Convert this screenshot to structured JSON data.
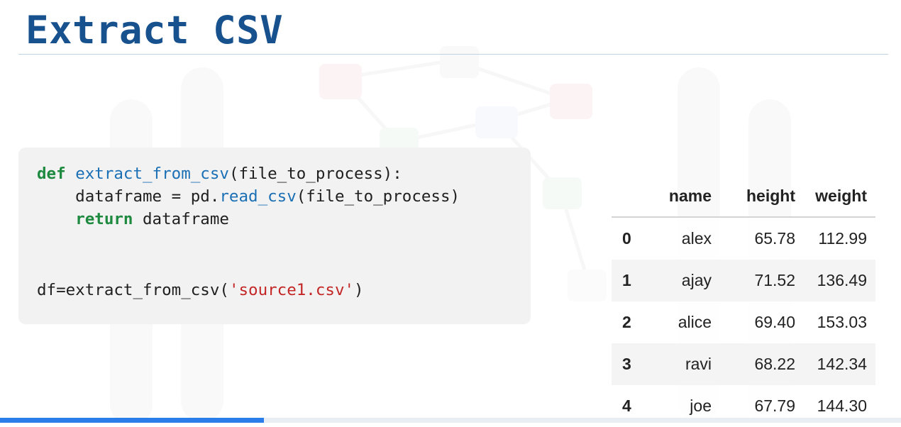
{
  "slide": {
    "title": "Extract CSV"
  },
  "code": {
    "line1": {
      "kw": "def",
      "fn": "extract_from_csv",
      "rest": "(file_to_process):"
    },
    "line2": {
      "pre": "    dataframe = pd.",
      "fn": "read_csv",
      "rest": "(file_to_process)"
    },
    "line3": {
      "indent": "    ",
      "kw": "return",
      "rest": " dataframe"
    },
    "line4": {
      "pre": "df=extract_from_csv(",
      "str": "'source1.csv'",
      "rest": ")"
    }
  },
  "table": {
    "columns": [
      "name",
      "height",
      "weight"
    ],
    "rows": [
      {
        "index": "0",
        "name": "alex",
        "height": "65.78",
        "weight": "112.99"
      },
      {
        "index": "1",
        "name": "ajay",
        "height": "71.52",
        "weight": "136.49"
      },
      {
        "index": "2",
        "name": "alice",
        "height": "69.40",
        "weight": "153.03"
      },
      {
        "index": "3",
        "name": "ravi",
        "height": "68.22",
        "weight": "142.34"
      },
      {
        "index": "4",
        "name": "joe",
        "height": "67.79",
        "weight": "144.30"
      }
    ]
  },
  "video": {
    "progress_fraction": 0.293,
    "progress_color": "#2b7de9"
  },
  "colors": {
    "title": "#17518e",
    "keyword": "#1d8a3f",
    "function": "#1a6fb5",
    "string": "#c42626"
  }
}
